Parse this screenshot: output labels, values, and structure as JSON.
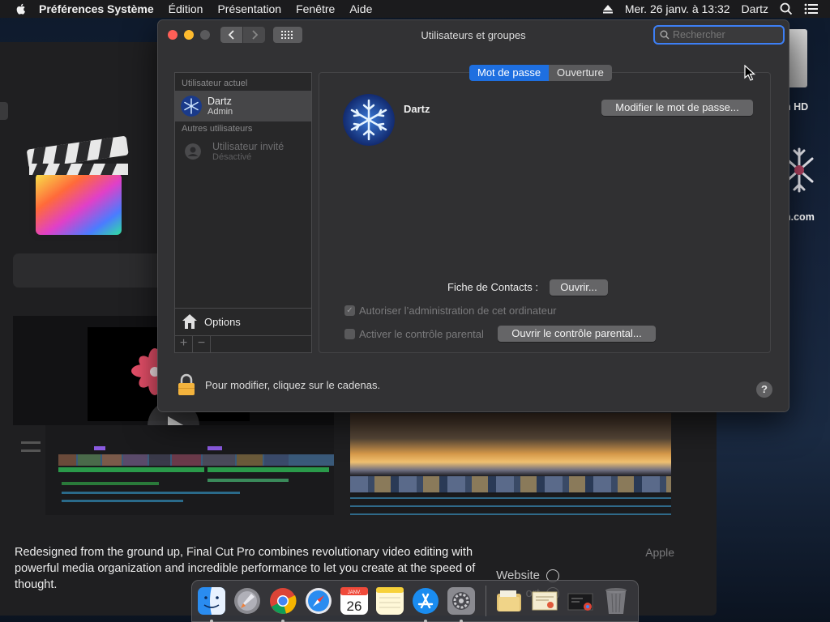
{
  "menubar": {
    "app_name": "Préférences Système",
    "items": [
      "Édition",
      "Présentation",
      "Fenêtre",
      "Aide"
    ],
    "clock": "Mer. 26 janv. à 13:32",
    "user": "Dartz"
  },
  "window": {
    "title": "Utilisateurs et groupes",
    "search_placeholder": "Rechercher"
  },
  "sidebar": {
    "current_section": "Utilisateur actuel",
    "current_user": {
      "name": "Dartz",
      "role": "Admin"
    },
    "other_section": "Autres utilisateurs",
    "guest_user": {
      "name": "Utilisateur invité",
      "status": "Désactivé"
    },
    "options_label": "Options",
    "add_label": "+",
    "remove_label": "−"
  },
  "tabs": [
    {
      "label": "Mot de passe",
      "active": true
    },
    {
      "label": "Ouverture",
      "active": false
    }
  ],
  "main": {
    "user_name": "Dartz",
    "modify_password_button": "Modifier le mot de passe...",
    "contacts_label": "Fiche de Contacts :",
    "open_button": "Ouvrir...",
    "allow_admin_label": "Autoriser l’administration de cet ordinateur",
    "allow_admin_checked": true,
    "parental_label": "Activer le contrôle parental",
    "parental_checked": false,
    "open_parental_button": "Ouvrir le contrôle parental..."
  },
  "footer": {
    "lock_text": "Pour modifier, cliquez sur le cadenas.",
    "help_label": "?"
  },
  "background_app": {
    "description": "Redesigned from the ground up, Final Cut Pro combines revolutionary video editing with powerful media organization and incredible performance to let you create at the speed of thought.",
    "developer": "Apple",
    "website_label": "Website",
    "support_label": "ort"
  },
  "desktop": {
    "disk_label": "n HD",
    "item_label": "n.com"
  },
  "dock": {
    "calendar_month": "JANV.",
    "calendar_day": "26",
    "apps": [
      "finder-icon",
      "launchpad-icon",
      "chrome-icon",
      "safari-icon",
      "calendar-icon",
      "notes-icon",
      "app-store-icon",
      "system-preferences-icon",
      "documents-folder-icon",
      "certificate-icon",
      "screenshot-icon",
      "trash-icon"
    ]
  },
  "colors": {
    "accent": "#1e6fe0",
    "window_bg": "#323234",
    "close": "#fe5f57",
    "minimize": "#febb2e"
  }
}
